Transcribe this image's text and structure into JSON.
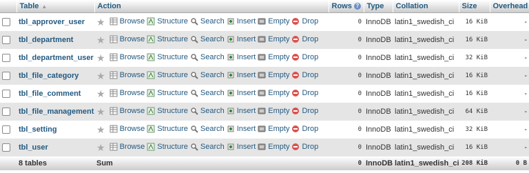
{
  "header": {
    "table": "Table",
    "action": "Action",
    "rows": "Rows",
    "type": "Type",
    "collation": "Collation",
    "size": "Size",
    "overhead": "Overhead"
  },
  "actions": {
    "browse": "Browse",
    "structure": "Structure",
    "search": "Search",
    "insert": "Insert",
    "empty": "Empty",
    "drop": "Drop"
  },
  "rows": [
    {
      "name": "tbl_approver_user",
      "rows": "0",
      "type": "InnoDB",
      "collation": "latin1_swedish_ci",
      "size": "16 KiB",
      "overhead": "-"
    },
    {
      "name": "tbl_department",
      "rows": "0",
      "type": "InnoDB",
      "collation": "latin1_swedish_ci",
      "size": "16 KiB",
      "overhead": "-"
    },
    {
      "name": "tbl_department_user",
      "rows": "0",
      "type": "InnoDB",
      "collation": "latin1_swedish_ci",
      "size": "32 KiB",
      "overhead": "-"
    },
    {
      "name": "tbl_file_category",
      "rows": "0",
      "type": "InnoDB",
      "collation": "latin1_swedish_ci",
      "size": "16 KiB",
      "overhead": "-"
    },
    {
      "name": "tbl_file_comment",
      "rows": "0",
      "type": "InnoDB",
      "collation": "latin1_swedish_ci",
      "size": "16 KiB",
      "overhead": "-"
    },
    {
      "name": "tbl_file_management",
      "rows": "0",
      "type": "InnoDB",
      "collation": "latin1_swedish_ci",
      "size": "64 KiB",
      "overhead": "-"
    },
    {
      "name": "tbl_setting",
      "rows": "0",
      "type": "InnoDB",
      "collation": "latin1_swedish_ci",
      "size": "32 KiB",
      "overhead": "-"
    },
    {
      "name": "tbl_user",
      "rows": "0",
      "type": "InnoDB",
      "collation": "latin1_swedish_ci",
      "size": "16 KiB",
      "overhead": "-"
    }
  ],
  "footer": {
    "count": "8 tables",
    "sum": "Sum",
    "rows": "0",
    "type": "InnoDB",
    "collation": "latin1_swedish_ci",
    "size": "208 KiB",
    "overhead": "0 B"
  },
  "colors": {
    "link": "#235a81",
    "drop": "#d9534f",
    "alt_row": "#e5e5e5"
  }
}
